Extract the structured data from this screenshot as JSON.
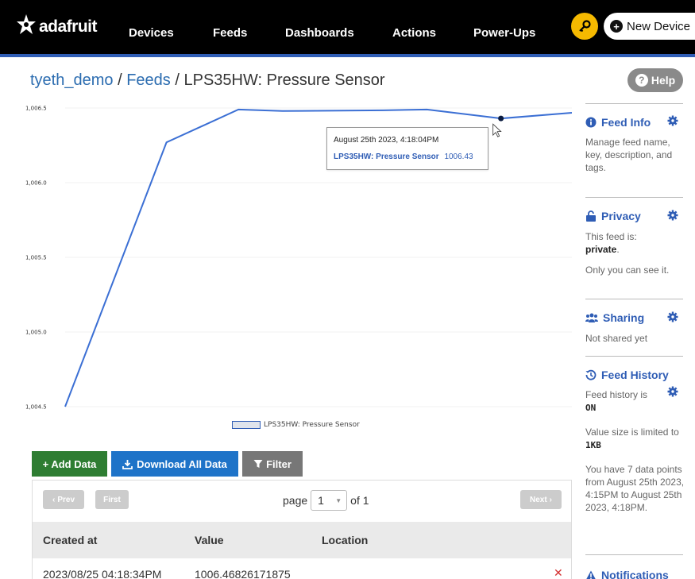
{
  "nav": {
    "brand": "adafruit",
    "links": [
      "Devices",
      "Feeds",
      "Dashboards",
      "Actions",
      "Power-Ups"
    ],
    "new_device_label": "New Device"
  },
  "breadcrumb": {
    "user": "tyeth_demo",
    "feeds": "Feeds",
    "current": "LPS35HW: Pressure Sensor"
  },
  "help_label": "Help",
  "chart_data": {
    "type": "line",
    "series": [
      {
        "name": "LPS35HW: Pressure Sensor",
        "color": "#3b6fd4",
        "points": [
          {
            "x": 0,
            "y": 1004.5
          },
          {
            "x": 1,
            "y": 1006.27
          },
          {
            "x": 2,
            "y": 1006.49
          },
          {
            "x": 3,
            "y": 1006.48
          },
          {
            "x": 4,
            "y": 1006.485
          },
          {
            "x": 5,
            "y": 1006.49
          },
          {
            "x": 6,
            "y": 1006.43
          },
          {
            "x": 7,
            "y": 1006.468
          }
        ]
      }
    ],
    "y_ticks": [
      "1,006.5",
      "1,006.0",
      "1,005.5",
      "1,005.0",
      "1,004.5"
    ],
    "ylim": [
      1004.5,
      1006.5
    ],
    "highlight_index": 6,
    "legend": "LPS35HW: Pressure Sensor",
    "tooltip": {
      "date": "August 25th 2023, 4:18:04PM",
      "series": "LPS35HW: Pressure Sensor",
      "value": "1006.43"
    }
  },
  "actions": {
    "add_data": "+ Add Data",
    "download_all": "Download All Data",
    "filter": "Filter"
  },
  "pager": {
    "prev": "Prev",
    "first": "First",
    "page_label": "page",
    "page_value": "1",
    "of_label": "of 1",
    "next": "Next"
  },
  "table": {
    "headers": [
      "Created at",
      "Value",
      "Location"
    ],
    "rows": [
      {
        "created_at": "2023/08/25 04:18:34PM",
        "value": "1006.46826171875",
        "location": ""
      }
    ]
  },
  "sidebar": {
    "feed_info": {
      "title": "Feed Info",
      "text": "Manage feed name, key, description, and tags."
    },
    "privacy": {
      "title": "Privacy",
      "text_prefix": "This feed is:",
      "status": "private",
      "text_suffix": "Only you can see it."
    },
    "sharing": {
      "title": "Sharing",
      "text": "Not shared yet"
    },
    "feed_history": {
      "title": "Feed History",
      "status_prefix": "Feed history is",
      "status": "ON",
      "size_prefix": "Value size is limited to",
      "size": "1KB",
      "points_text": "You have 7 data points from August 25th 2023, 4:15PM to August 25th 2023, 4:18PM."
    },
    "notifications": {
      "title": "Notifications"
    }
  },
  "colors": {
    "accent_blue": "#2f5db5",
    "link_blue": "#2b6cb0",
    "add_green": "#2e7d32",
    "download_blue": "#1e73c8",
    "filter_gray": "#777777",
    "key_yellow": "#f5b900",
    "delete_red": "#d32f2f"
  }
}
